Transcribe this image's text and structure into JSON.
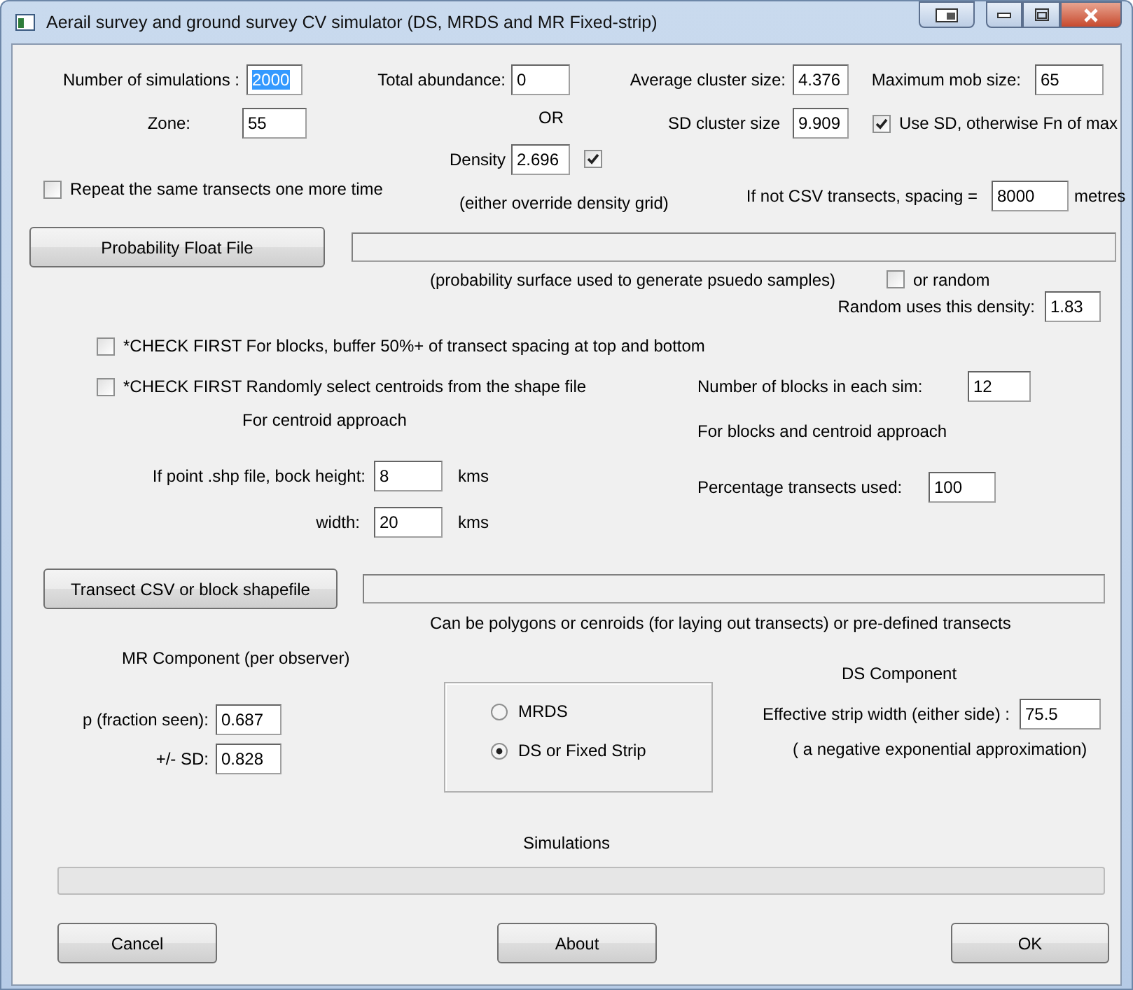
{
  "window": {
    "title": "Aerail survey and ground survey CV simulator (DS, MRDS and MR Fixed-strip)"
  },
  "top_fields": [
    {
      "label": "Number of simulations :",
      "value": "2000",
      "focused": true
    },
    {
      "label": "Total abundance:",
      "value": "0",
      "focused": false
    },
    {
      "label": "Average cluster size:",
      "value": "4.376",
      "focused": false
    },
    {
      "label": "Maximum mob size:",
      "value": "65",
      "focused": false
    }
  ],
  "zone": {
    "label": "Zone:",
    "value": "55"
  },
  "or_label": "OR",
  "sd_cluster": {
    "label": "SD cluster size",
    "value": "9.909"
  },
  "use_sd": {
    "label": "Use SD, otherwise Fn of max",
    "checked": true
  },
  "density": {
    "label": "Density",
    "value": "2.696",
    "checked": true
  },
  "repeat": {
    "label": "Repeat the same transects one more time",
    "checked": false
  },
  "density_note": "(either override density grid)",
  "spacing": {
    "label": "If not CSV transects, spacing  =",
    "value": "8000",
    "unit": "metres"
  },
  "prob_file": {
    "button": "Probability Float File"
  },
  "prob_note": "(probability surface used to generate psuedo samples)",
  "or_random": {
    "label": "or random",
    "checked": false
  },
  "random_density": {
    "label": "Random uses this density:",
    "value": "1.83"
  },
  "check_first": [
    {
      "label": "*CHECK FIRST  For blocks, buffer 50%+ of transect spacing at top and bottom",
      "checked": false
    },
    {
      "label": "*CHECK FIRST  Randomly select centroids from the shape file",
      "checked": false
    }
  ],
  "blocks": {
    "label": "Number of blocks in each sim:",
    "value": "12"
  },
  "centroid_heading": "For centroid approach",
  "blocks_heading": "For blocks and centroid approach",
  "block_size": [
    {
      "label": "If point .shp file, bock height:",
      "value": "8",
      "unit": "kms"
    },
    {
      "label": "width:",
      "value": "20",
      "unit": "kms"
    }
  ],
  "percentage": {
    "label": "Percentage transects used:",
    "value": "100"
  },
  "transect_file": {
    "button": "Transect CSV or block shapefile"
  },
  "transect_note": "Can be polygons or cenroids (for laying out transects) or pre-defined transects",
  "mr": {
    "heading": "MR Component (per observer)",
    "fields": [
      {
        "label": "p (fraction seen):",
        "value": "0.687"
      },
      {
        "label": "+/- SD:",
        "value": "0.828"
      }
    ]
  },
  "method": [
    {
      "label": "MRDS",
      "selected": false
    },
    {
      "label": "DS or Fixed Strip",
      "selected": true
    }
  ],
  "ds": {
    "heading": "DS Component",
    "label": "Effective strip width (either side) :",
    "value": "75.5",
    "note": "( a negative exponential approximation)"
  },
  "progress": {
    "label": "Simulations",
    "level": 0
  },
  "buttons": [
    "Cancel",
    "About",
    "OK"
  ]
}
